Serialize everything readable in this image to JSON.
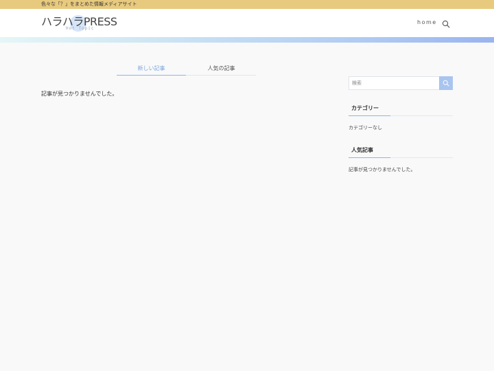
{
  "topbar": {
    "tagline": "色々な「？」をまとめた情報メディアサイト"
  },
  "header": {
    "logo_title": "ハラハラPRESS",
    "logo_subtitle": "Hot Topic",
    "nav": [
      {
        "label": "home"
      }
    ],
    "search_icon": "search-icon"
  },
  "main": {
    "tabs": [
      {
        "label": "新しい記事",
        "active": true
      },
      {
        "label": "人気の記事",
        "active": false
      }
    ],
    "empty_message": "記事が見つかりませんでした。"
  },
  "sidebar": {
    "search": {
      "placeholder": "検索",
      "value": ""
    },
    "widgets": [
      {
        "title": "カテゴリー",
        "text": "カテゴリーなし"
      },
      {
        "title": "人気記事",
        "text": "記事が見つかりませんでした。"
      }
    ]
  },
  "colors": {
    "topbar": "#e8ca7f",
    "accent": "#8fb4e6",
    "search_button": "#a9c4ef",
    "background": "#f9f9f9"
  }
}
